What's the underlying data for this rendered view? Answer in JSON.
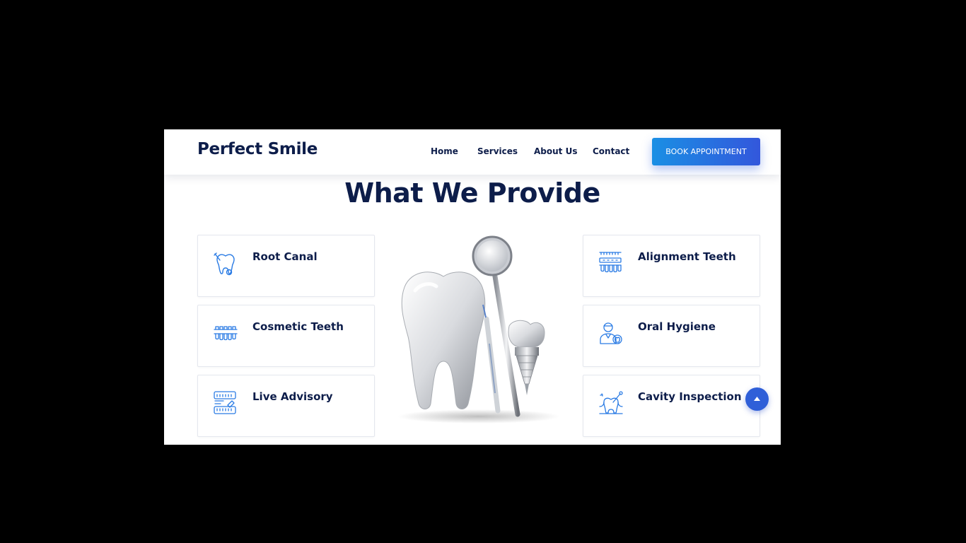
{
  "header": {
    "brand": "Perfect Smile",
    "nav": [
      {
        "label": "Home"
      },
      {
        "label": "Services"
      },
      {
        "label": "About Us"
      },
      {
        "label": "Contact"
      }
    ],
    "cta_label": "BOOK APPOINTMENT"
  },
  "services": {
    "title": "What We Provide",
    "left": [
      {
        "label": "Root Canal",
        "icon": "root-canal-icon"
      },
      {
        "label": "Cosmetic Teeth",
        "icon": "cosmetic-teeth-icon"
      },
      {
        "label": "Live Advisory",
        "icon": "live-advisory-icon"
      }
    ],
    "right": [
      {
        "label": "Alignment Teeth",
        "icon": "alignment-teeth-icon"
      },
      {
        "label": "Oral Hygiene",
        "icon": "oral-hygiene-icon"
      },
      {
        "label": "Cavity Inspection",
        "icon": "cavity-inspection-icon"
      }
    ]
  },
  "colors": {
    "brand_navy": "#0d1d4a",
    "accent_blue": "#1a8fe4",
    "accent_indigo": "#3357dc",
    "background": "#ffffff"
  }
}
